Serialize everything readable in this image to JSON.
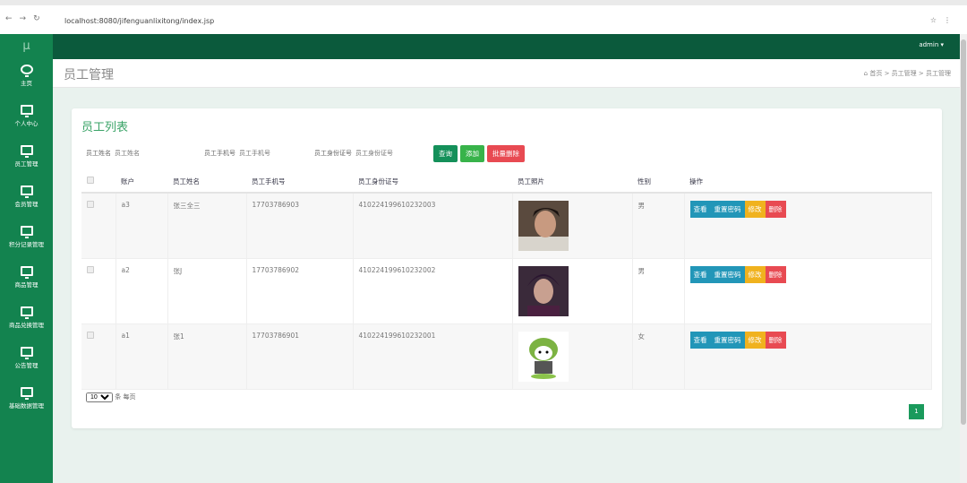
{
  "browser": {
    "url": "localhost:8080/jifenguanlixitong/index.jsp"
  },
  "header": {
    "user": "admin ▾"
  },
  "sidebar": {
    "logo": "μ",
    "items": [
      {
        "label": "主页"
      },
      {
        "label": "个人中心"
      },
      {
        "label": "员工管理"
      },
      {
        "label": "会员管理"
      },
      {
        "label": "积分记录管理"
      },
      {
        "label": "商品管理"
      },
      {
        "label": "商品兑换管理"
      },
      {
        "label": "公告管理"
      },
      {
        "label": "基础数据管理"
      }
    ]
  },
  "page": {
    "title": "员工管理",
    "breadcrumb": [
      "首页",
      "员工管理",
      "员工管理"
    ]
  },
  "card": {
    "title": "员工列表"
  },
  "search": {
    "name_label": "员工姓名",
    "name_ph": "员工姓名",
    "phone_label": "员工手机号",
    "phone_ph": "员工手机号",
    "id_label": "员工身份证号",
    "id_ph": "员工身份证号",
    "query": "查询",
    "add": "添加",
    "batch_delete": "批量删除"
  },
  "table": {
    "headers": [
      "账户",
      "员工姓名",
      "员工手机号",
      "员工身份证号",
      "员工照片",
      "性别",
      "操作"
    ],
    "rows": [
      {
        "account": "a3",
        "name": "张三全三",
        "phone": "17703786903",
        "idcard": "410224199610232003",
        "gender": "男"
      },
      {
        "account": "a2",
        "name": "张J",
        "phone": "17703786902",
        "idcard": "410224199610232002",
        "gender": "男"
      },
      {
        "account": "a1",
        "name": "张1",
        "phone": "17703786901",
        "idcard": "410224199610232001",
        "gender": "女"
      }
    ],
    "actions": {
      "view": "查看",
      "reset": "重置密码",
      "edit": "修改",
      "delete": "删除"
    }
  },
  "pager": {
    "size": "10",
    "per_page": "条 每页",
    "current": "1"
  }
}
